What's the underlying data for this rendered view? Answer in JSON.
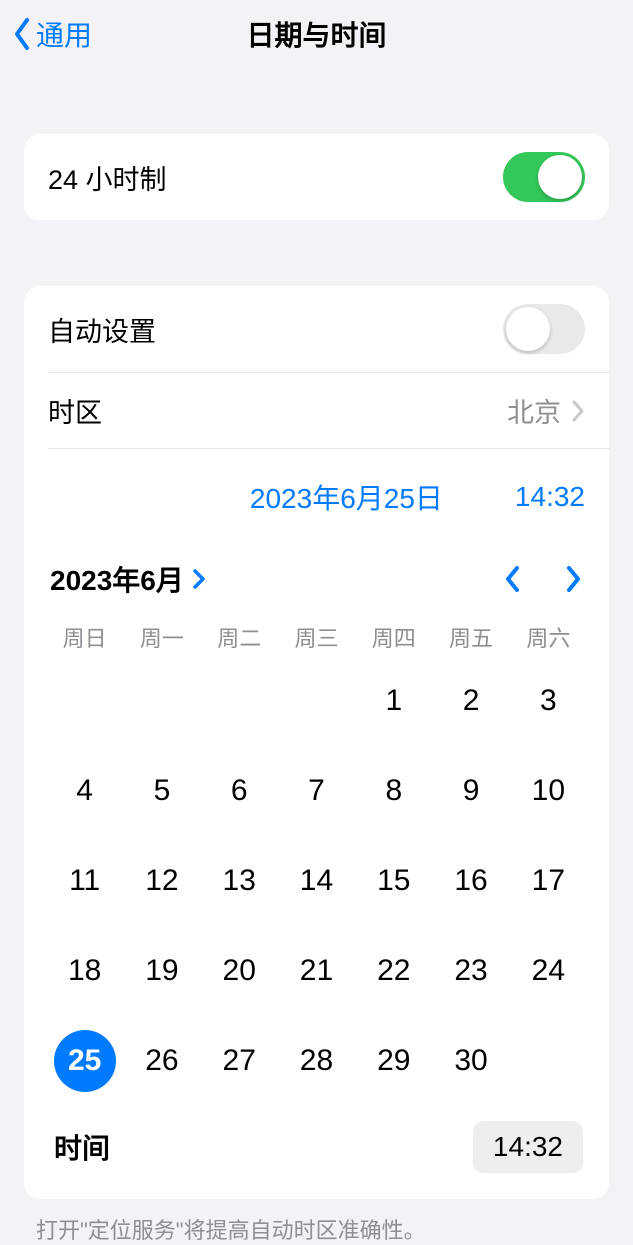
{
  "header": {
    "back_label": "通用",
    "title": "日期与时间"
  },
  "clock24": {
    "label": "24 小时制",
    "enabled": true
  },
  "autoset": {
    "label": "自动设置",
    "enabled": false
  },
  "timezone": {
    "label": "时区",
    "value": "北京"
  },
  "date_display": "2023年6月25日",
  "time_display": "14:32",
  "calendar": {
    "month_label": "2023年6月",
    "weekdays": [
      "周日",
      "周一",
      "周二",
      "周三",
      "周四",
      "周五",
      "周六"
    ],
    "leading_blanks": 4,
    "days_in_month": 30,
    "selected_day": 25
  },
  "time_row": {
    "label": "时间",
    "value": "14:32"
  },
  "footer_note": "打开\"定位服务\"将提高自动时区准确性。"
}
